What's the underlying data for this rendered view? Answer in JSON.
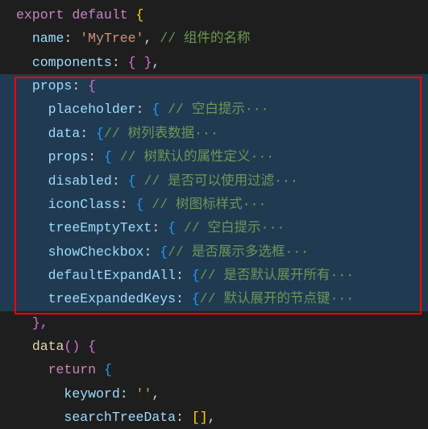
{
  "code": {
    "line1": {
      "export": "export",
      "default": "default",
      "brace": "{"
    },
    "line2": {
      "prop": "name",
      "value": "'MyTree'",
      "comment": "// 组件的名称"
    },
    "line3": {
      "prop": "components",
      "braces": "{ }"
    },
    "line4": {
      "prop": "props",
      "brace": "{"
    },
    "line5": {
      "prop": "placeholder",
      "brace": "{",
      "comment": "// 空白提示···"
    },
    "line6": {
      "prop": "data",
      "brace": "{",
      "comment": "// 树列表数据···"
    },
    "line7": {
      "prop": "props",
      "brace": "{",
      "comment": "// 树默认的属性定义···"
    },
    "line8": {
      "prop": "disabled",
      "brace": "{",
      "comment": "// 是否可以使用过滤···"
    },
    "line9": {
      "prop": "iconClass",
      "brace": "{",
      "comment": "// 树图标样式···"
    },
    "line10": {
      "prop": "treeEmptyText",
      "brace": "{",
      "comment": "// 空白提示···"
    },
    "line11": {
      "prop": "showCheckbox",
      "brace": "{",
      "comment": "// 是否展示多选框···"
    },
    "line12": {
      "prop": "defaultExpandAll",
      "brace": "{",
      "comment": "// 是否默认展开所有···"
    },
    "line13": {
      "prop": "treeExpandedKeys",
      "brace": "{",
      "comment": "// 默认展开的节点键···"
    },
    "line14": {
      "close": "},"
    },
    "line15": {
      "method": "data",
      "parens": "()",
      "brace": "{"
    },
    "line16": {
      "return": "return",
      "brace": "{"
    },
    "line17": {
      "prop": "keyword",
      "value": "''"
    },
    "line18": {
      "prop": "searchTreeData",
      "value": "[]"
    }
  }
}
